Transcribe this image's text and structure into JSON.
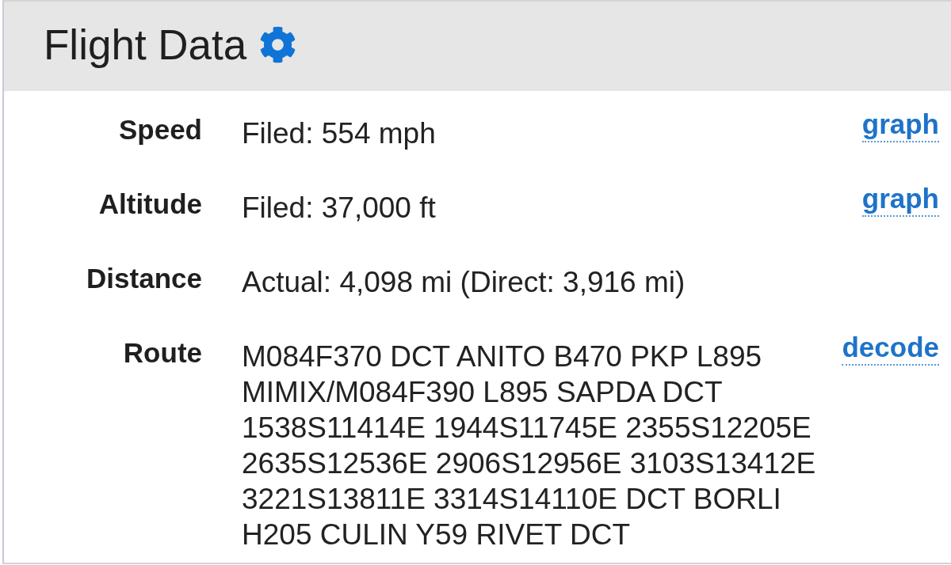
{
  "panel": {
    "title": "Flight Data"
  },
  "rows": [
    {
      "label": "Speed",
      "value": "Filed: 554 mph",
      "link": "graph"
    },
    {
      "label": "Altitude",
      "value": "Filed: 37,000 ft",
      "link": "graph"
    },
    {
      "label": "Distance",
      "value": "Actual: 4,098 mi (Direct: 3,916 mi)"
    },
    {
      "label": "Route",
      "value": "M084F370 DCT ANITO B470 PKP L895 MIMIX/M084F390 L895 SAPDA DCT 1538S11414E 1944S11745E 2355S12205E 2635S12536E 2906S12956E 3103S13412E 3221S13811E 3314S14110E DCT BORLI H205 CULIN Y59 RIVET DCT",
      "link": "decode"
    }
  ]
}
